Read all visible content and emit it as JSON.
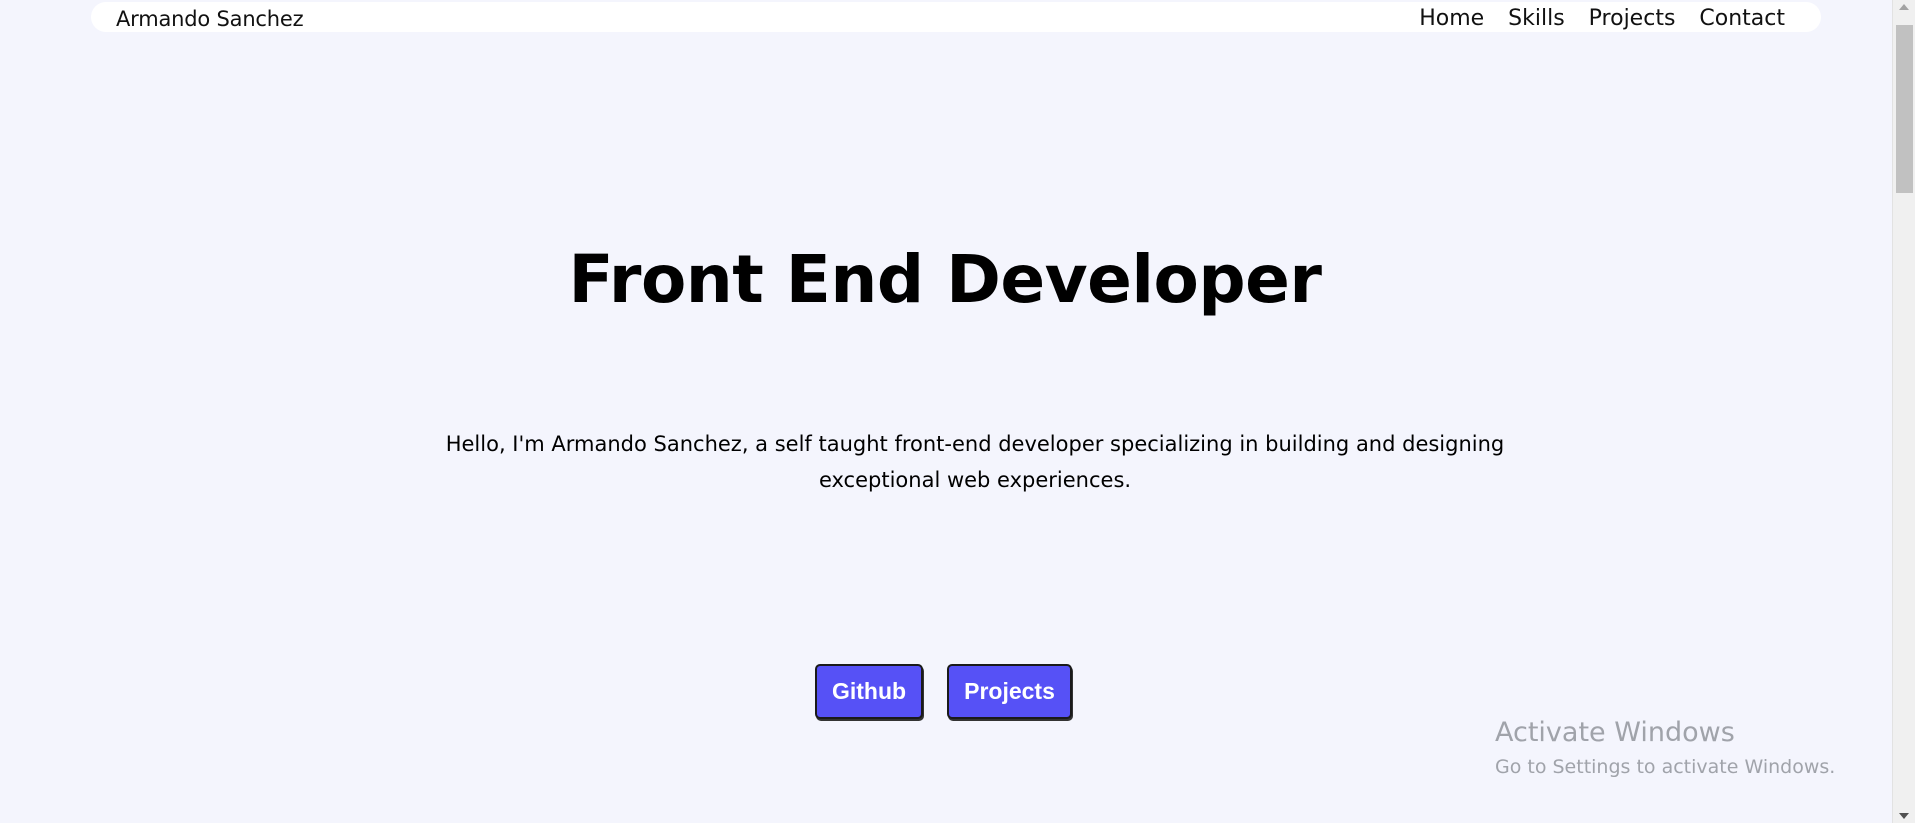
{
  "nav": {
    "brand": "Armando Sanchez",
    "links": [
      "Home",
      "Skills",
      "Projects",
      "Contact"
    ]
  },
  "hero": {
    "title": "Front End Developer",
    "description": "Hello, I'm Armando Sanchez, a self taught front-end developer specializing in building and designing exceptional web experiences."
  },
  "buttons": {
    "github": "Github",
    "projects": "Projects"
  },
  "watermark": {
    "title": "Activate Windows",
    "subtitle": "Go to Settings to activate Windows."
  },
  "colors": {
    "background": "#f4f5fd",
    "button": "#5651f6",
    "navbar": "#ffffff"
  }
}
